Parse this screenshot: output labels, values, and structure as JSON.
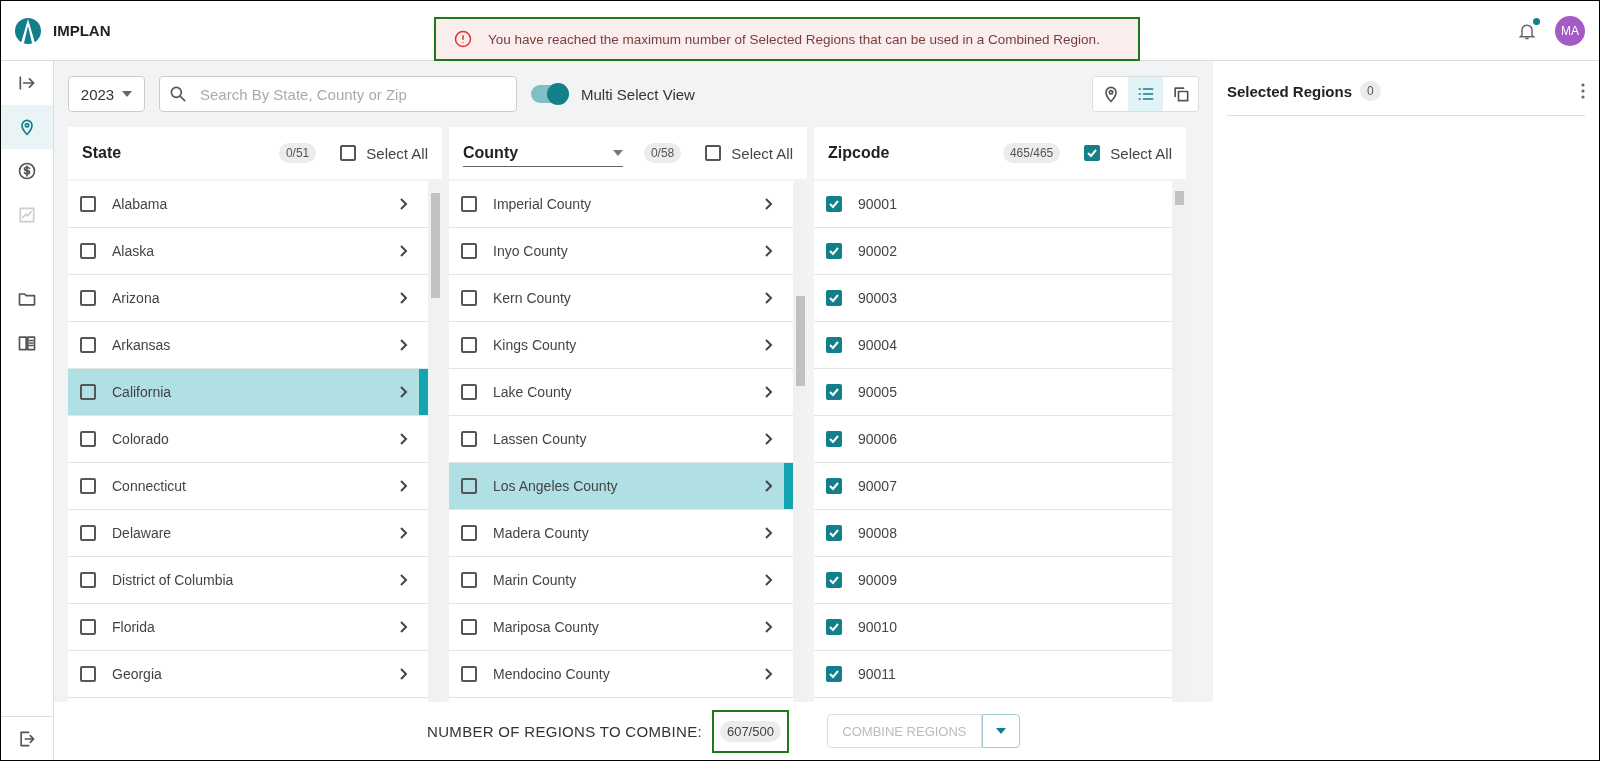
{
  "header": {
    "brand": "IMPLAN",
    "alert": "You have reached the maximum number of Selected Regions that can be used in a Combined Region.",
    "notification_dot": true,
    "avatar": "MA"
  },
  "nav": [
    {
      "kind": "expand",
      "selected": false
    },
    {
      "kind": "map",
      "selected": true
    },
    {
      "kind": "money",
      "selected": false
    },
    {
      "kind": "chart",
      "selected": false,
      "disabled": true
    },
    {
      "kind": "folder",
      "selected": false
    },
    {
      "kind": "book",
      "selected": false
    }
  ],
  "toolbar": {
    "year": "2023",
    "search_placeholder": "Search By State, County or Zip",
    "toggle": {
      "label": "Multi Select View",
      "on": true
    },
    "views": [
      {
        "kind": "map",
        "selected": false
      },
      {
        "kind": "list",
        "selected": true
      },
      {
        "kind": "copy",
        "selected": false
      }
    ]
  },
  "columns": [
    {
      "title": "State",
      "kind": "plain",
      "count": "0/51",
      "select_all": {
        "label": "Select All",
        "checked": false
      },
      "chevrons": true,
      "rows": [
        {
          "label": "Alabama",
          "checked": false,
          "selected": false
        },
        {
          "label": "Alaska",
          "checked": false,
          "selected": false
        },
        {
          "label": "Arizona",
          "checked": false,
          "selected": false
        },
        {
          "label": "Arkansas",
          "checked": false,
          "selected": false
        },
        {
          "label": "California",
          "checked": false,
          "selected": true
        },
        {
          "label": "Colorado",
          "checked": false,
          "selected": false
        },
        {
          "label": "Connecticut",
          "checked": false,
          "selected": false
        },
        {
          "label": "Delaware",
          "checked": false,
          "selected": false
        },
        {
          "label": "District of Columbia",
          "checked": false,
          "selected": false
        },
        {
          "label": "Florida",
          "checked": false,
          "selected": false
        },
        {
          "label": "Georgia",
          "checked": false,
          "selected": false
        }
      ]
    },
    {
      "title": "County",
      "kind": "dropdown",
      "count": "0/58",
      "select_all": {
        "label": "Select All",
        "checked": false
      },
      "chevrons": true,
      "rows": [
        {
          "label": "Imperial County",
          "checked": false,
          "selected": false
        },
        {
          "label": "Inyo County",
          "checked": false,
          "selected": false
        },
        {
          "label": "Kern County",
          "checked": false,
          "selected": false
        },
        {
          "label": "Kings County",
          "checked": false,
          "selected": false
        },
        {
          "label": "Lake County",
          "checked": false,
          "selected": false
        },
        {
          "label": "Lassen County",
          "checked": false,
          "selected": false
        },
        {
          "label": "Los Angeles County",
          "checked": false,
          "selected": true
        },
        {
          "label": "Madera County",
          "checked": false,
          "selected": false
        },
        {
          "label": "Marin County",
          "checked": false,
          "selected": false
        },
        {
          "label": "Mariposa County",
          "checked": false,
          "selected": false
        },
        {
          "label": "Mendocino County",
          "checked": false,
          "selected": false
        }
      ]
    },
    {
      "title": "Zipcode",
      "kind": "plain",
      "count": "465/465",
      "select_all": {
        "label": "Select All",
        "checked": true
      },
      "chevrons": false,
      "rows": [
        {
          "label": "90001",
          "checked": true,
          "selected": false
        },
        {
          "label": "90002",
          "checked": true,
          "selected": false
        },
        {
          "label": "90003",
          "checked": true,
          "selected": false
        },
        {
          "label": "90004",
          "checked": true,
          "selected": false
        },
        {
          "label": "90005",
          "checked": true,
          "selected": false
        },
        {
          "label": "90006",
          "checked": true,
          "selected": false
        },
        {
          "label": "90007",
          "checked": true,
          "selected": false
        },
        {
          "label": "90008",
          "checked": true,
          "selected": false
        },
        {
          "label": "90009",
          "checked": true,
          "selected": false
        },
        {
          "label": "90010",
          "checked": true,
          "selected": false
        },
        {
          "label": "90011",
          "checked": true,
          "selected": false
        }
      ]
    }
  ],
  "footer": {
    "label": "NUMBER OF REGIONS TO COMBINE:",
    "count": "607/500",
    "button": {
      "label": "COMBINE REGIONS",
      "disabled": true
    }
  },
  "selected_panel": {
    "title": "Selected Regions",
    "count": "0"
  }
}
